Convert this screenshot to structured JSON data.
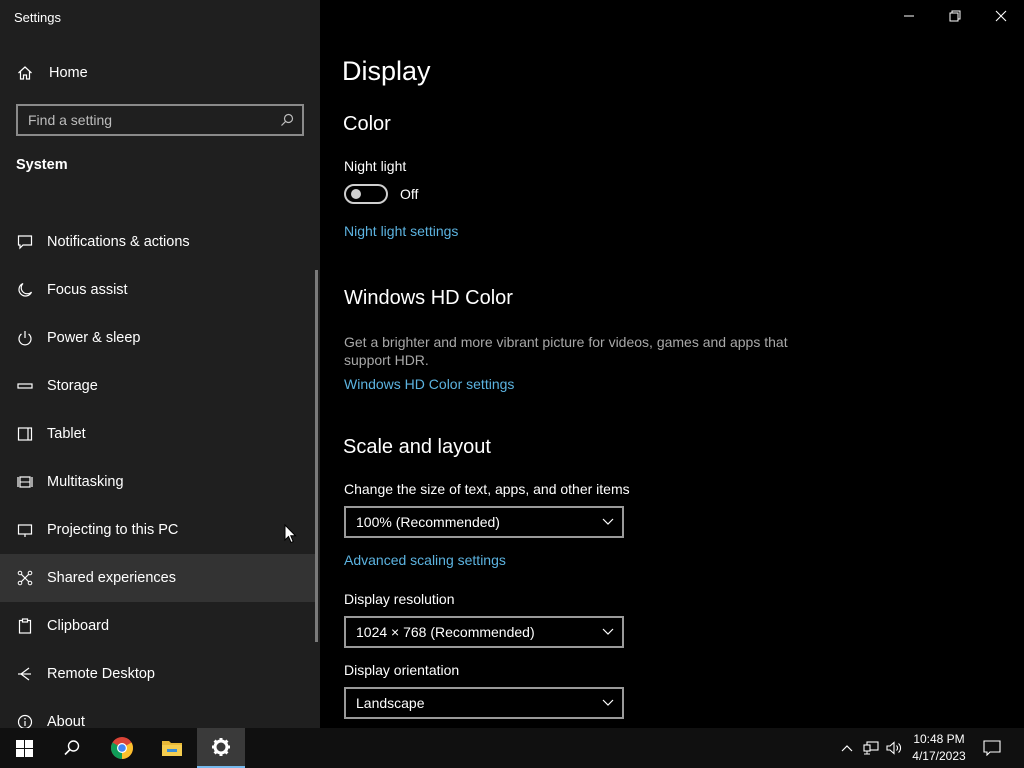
{
  "window": {
    "app_title": "Settings"
  },
  "sidebar": {
    "home_label": "Home",
    "search_placeholder": "Find a setting",
    "section_title": "System",
    "items": [
      {
        "label": "Notifications & actions",
        "icon": "notifications-icon"
      },
      {
        "label": "Focus assist",
        "icon": "moon-icon"
      },
      {
        "label": "Power & sleep",
        "icon": "power-icon"
      },
      {
        "label": "Storage",
        "icon": "storage-icon"
      },
      {
        "label": "Tablet",
        "icon": "tablet-icon"
      },
      {
        "label": "Multitasking",
        "icon": "multitasking-icon"
      },
      {
        "label": "Projecting to this PC",
        "icon": "projecting-icon"
      },
      {
        "label": "Shared experiences",
        "icon": "shared-experiences-icon",
        "active": true
      },
      {
        "label": "Clipboard",
        "icon": "clipboard-icon"
      },
      {
        "label": "Remote Desktop",
        "icon": "remote-desktop-icon"
      },
      {
        "label": "About",
        "icon": "info-icon"
      }
    ]
  },
  "main": {
    "page_title": "Display",
    "color": {
      "heading": "Color",
      "night_light_label": "Night light",
      "night_light_state": "Off",
      "night_light_settings_link": "Night light settings"
    },
    "hd_color": {
      "heading": "Windows HD Color",
      "description": "Get a brighter and more vibrant picture for videos, games and apps that support HDR.",
      "settings_link": "Windows HD Color settings"
    },
    "scale_layout": {
      "heading": "Scale and layout",
      "scale_label": "Change the size of text, apps, and other items",
      "scale_value": "100% (Recommended)",
      "advanced_link": "Advanced scaling settings",
      "resolution_label": "Display resolution",
      "resolution_value": "1024 × 768 (Recommended)",
      "orientation_label": "Display orientation",
      "orientation_value": "Landscape"
    }
  },
  "taskbar": {
    "time": "10:48 PM",
    "date": "4/17/2023",
    "apps": [
      "start-icon",
      "search-icon",
      "chrome-icon",
      "file-explorer-icon",
      "settings-icon"
    ]
  },
  "colors": {
    "accent_link": "#5cb3e0",
    "sidebar_bg": "#1f1f1f",
    "main_bg": "#000000",
    "taskbar_bg": "#101010"
  }
}
